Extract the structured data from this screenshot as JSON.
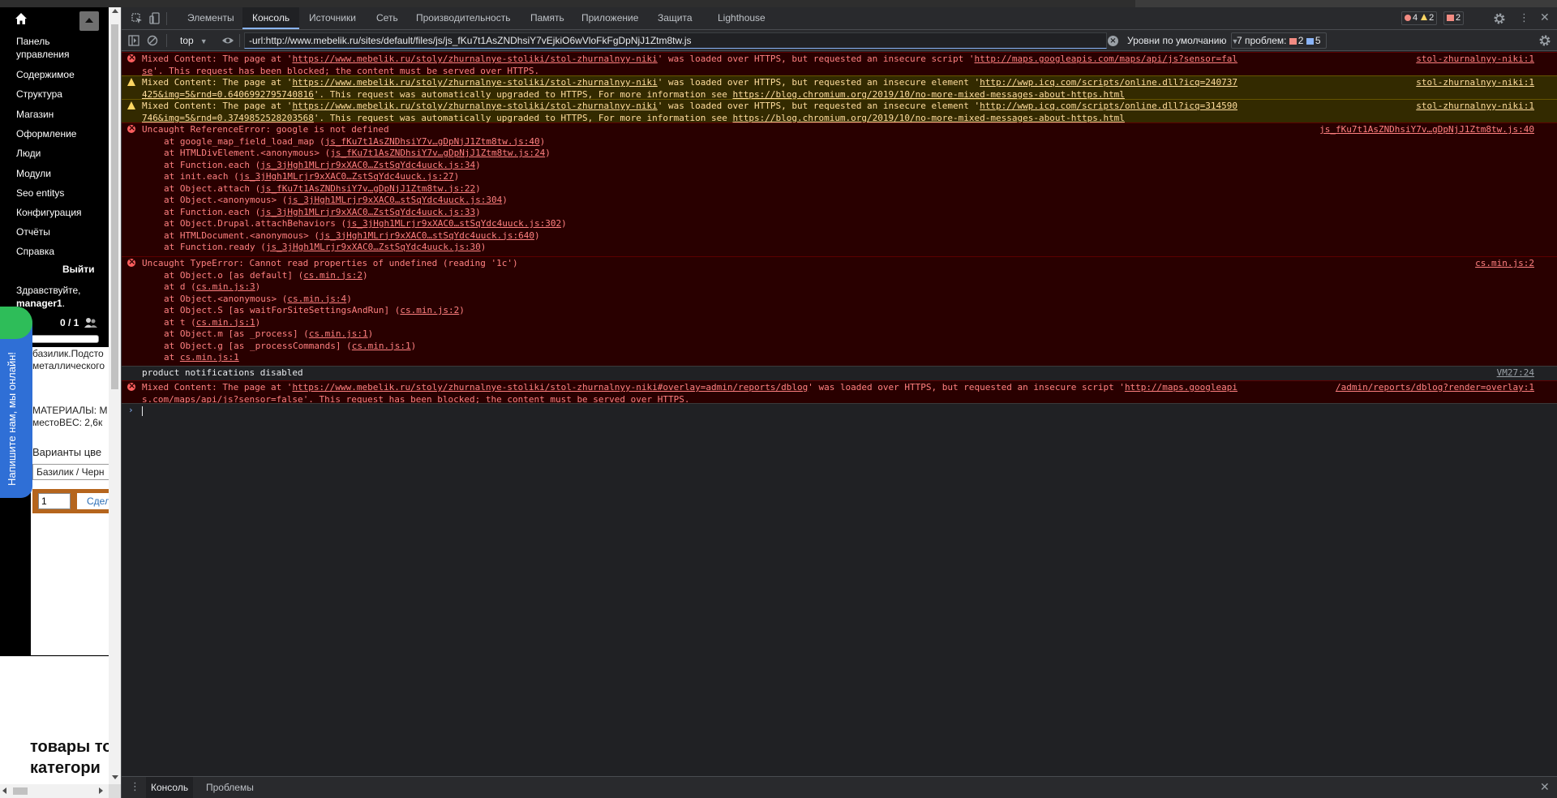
{
  "page": {
    "menu_items": [
      "Панель управления",
      "Содержимое",
      "Структура",
      "Магазин",
      "Оформление",
      "Люди",
      "Модули",
      "Seo entitys",
      "Конфигурация",
      "Отчёты",
      "Справка"
    ],
    "logout_label": "Выйти",
    "greeting_prefix": "Здравствуйте,",
    "greeting_user": "manager1",
    "greeting_suffix": ".",
    "online_counter": "0 / 1",
    "text_line_1": "базилик.Подсто",
    "text_line_2": "металлического",
    "text_line_3": "МАТЕРИАЛЫ: М",
    "text_line_4": "местоВЕС: 2,6к",
    "variants_label": "Варианты цве",
    "variant_value": "Базилик / Черн",
    "quantity_value": "1",
    "buy_label": "Сдел",
    "goods_heading_1": "товары то",
    "goods_heading_2": "категори",
    "chat_widget_label": "Напишите нам, мы онлайн!"
  },
  "devtools": {
    "tabs": [
      "Элементы",
      "Консоль",
      "Источники",
      "Сеть",
      "Производительность",
      "Память",
      "Приложение",
      "Защита",
      "Lighthouse"
    ],
    "active_tab": "Консоль",
    "counts": {
      "errors": "4",
      "warnings": "2",
      "issues": "2"
    },
    "toolbar": {
      "context": "top",
      "filter_value": "-url:http://www.mebelik.ru/sites/default/files/js/js_fKu7t1AsZNDhsiY7vEjkiO6wVloFkFgDpNjJ1Ztm8tw.js",
      "levels": "Уровни по умолчанию",
      "issues_label": "7 проблем:",
      "issues_errors": "2",
      "issues_info": "5"
    },
    "drawer_tabs": [
      "Консоль",
      "Проблемы"
    ]
  },
  "console": {
    "msg1": {
      "t1": "Mixed Content: The page at '",
      "l1": "https://www.mebelik.ru/stoly/zhurnalnye-stoliki/stol-zhurnalnyy-niki",
      "t2": "' was loaded over HTTPS, but requested an insecure script '",
      "l2": "http://maps.googleapis.com/maps/api/js?sensor=false",
      "t3": "'. This request has been blocked; the content must be served over HTTPS.",
      "src": "stol-zhurnalnyy-niki:1"
    },
    "msg2": {
      "t1": "Mixed Content: The page at '",
      "l1": "https://www.mebelik.ru/stoly/zhurnalnye-stoliki/stol-zhurnalnyy-niki",
      "t2": "' was loaded over HTTPS, but requested an insecure element '",
      "l2": "http://wwp.icq.com/scripts/online.dll?icq=240737425&img=5&rnd=0.6406992795740816",
      "t3": "'. This request was automatically upgraded to HTTPS, For more information see ",
      "l3": "https://blog.chromium.org/2019/10/no-more-mixed-messages-about-https.html",
      "src": "stol-zhurnalnyy-niki:1"
    },
    "msg3": {
      "t1": "Mixed Content: The page at '",
      "l1": "https://www.mebelik.ru/stoly/zhurnalnye-stoliki/stol-zhurnalnyy-niki",
      "t2": "' was loaded over HTTPS, but requested an insecure element '",
      "l2": "http://wwp.icq.com/scripts/online.dll?icq=314590746&img=5&rnd=0.3749852528203568",
      "t3": "'. This request was automatically upgraded to HTTPS, For more information see ",
      "l3": "https://blog.chromium.org/2019/10/no-more-mixed-messages-about-https.html",
      "src": "stol-zhurnalnyy-niki:1"
    },
    "msg4": {
      "title": "Uncaught ReferenceError: google is not defined",
      "src": "js_fKu7t1AsZNDhsiY7v…gDpNjJ1Ztm8tw.js:40",
      "stack": [
        {
          "fn": "at google_map_field_load_map (",
          "loc": "js_fKu7t1AsZNDhsiY7v…gDpNjJ1Ztm8tw.js:40",
          "end": ")"
        },
        {
          "fn": "at HTMLDivElement.<anonymous> (",
          "loc": "js_fKu7t1AsZNDhsiY7v…gDpNjJ1Ztm8tw.js:24",
          "end": ")"
        },
        {
          "fn": "at Function.each (",
          "loc": "js_3jHgh1MLrjr9xXAC0…ZstSqYdc4uuck.js:34",
          "end": ")"
        },
        {
          "fn": "at init.each (",
          "loc": "js_3jHgh1MLrjr9xXAC0…ZstSqYdc4uuck.js:27",
          "end": ")"
        },
        {
          "fn": "at Object.attach (",
          "loc": "js_fKu7t1AsZNDhsiY7v…gDpNjJ1Ztm8tw.js:22",
          "end": ")"
        },
        {
          "fn": "at Object.<anonymous> (",
          "loc": "js_3jHgh1MLrjr9xXAC0…stSqYdc4uuck.js:304",
          "end": ")"
        },
        {
          "fn": "at Function.each (",
          "loc": "js_3jHgh1MLrjr9xXAC0…ZstSqYdc4uuck.js:33",
          "end": ")"
        },
        {
          "fn": "at Object.Drupal.attachBehaviors (",
          "loc": "js_3jHgh1MLrjr9xXAC0…stSqYdc4uuck.js:302",
          "end": ")"
        },
        {
          "fn": "at HTMLDocument.<anonymous> (",
          "loc": "js_3jHgh1MLrjr9xXAC0…stSqYdc4uuck.js:640",
          "end": ")"
        },
        {
          "fn": "at Function.ready (",
          "loc": "js_3jHgh1MLrjr9xXAC0…ZstSqYdc4uuck.js:30",
          "end": ")"
        }
      ]
    },
    "msg5": {
      "title": "Uncaught TypeError: Cannot read properties of undefined (reading '1c')",
      "src": "cs.min.js:2",
      "stack": [
        {
          "fn": "at Object.o [as default] (",
          "loc": "cs.min.js:2",
          "end": ")"
        },
        {
          "fn": "at d (",
          "loc": "cs.min.js:3",
          "end": ")"
        },
        {
          "fn": "at Object.<anonymous> (",
          "loc": "cs.min.js:4",
          "end": ")"
        },
        {
          "fn": "at Object.S [as waitForSiteSettingsAndRun] (",
          "loc": "cs.min.js:2",
          "end": ")"
        },
        {
          "fn": "at t (",
          "loc": "cs.min.js:1",
          "end": ")"
        },
        {
          "fn": "at Object.m [as _process] (",
          "loc": "cs.min.js:1",
          "end": ")"
        },
        {
          "fn": "at Object.g [as _processCommands] (",
          "loc": "cs.min.js:1",
          "end": ")"
        },
        {
          "fn": "at ",
          "loc": "cs.min.js:1",
          "end": ""
        }
      ]
    },
    "msg6": {
      "text": "product notifications disabled",
      "src": "VM27:24"
    },
    "msg7": {
      "t1": "Mixed Content: The page at '",
      "l1": "https://www.mebelik.ru/stoly/zhurnalnye-stoliki/stol-zhurnalnyy-niki#overlay=admin/reports/dblog",
      "t2": "' was loaded over HTTPS, but requested an insecure script '",
      "l2": "http://maps.googleapis.com/maps/api/js?sensor=false",
      "t3": "'. This request has been blocked; the content must be served over HTTPS.",
      "src": "/admin/reports/dblog?render=overlay:1"
    }
  },
  "colors": {
    "error_bg": "#290000",
    "error_text": "#ff8080",
    "warn_bg": "#332a00",
    "warn_text": "#ffdd9e",
    "accent": "#8ab4f8"
  }
}
